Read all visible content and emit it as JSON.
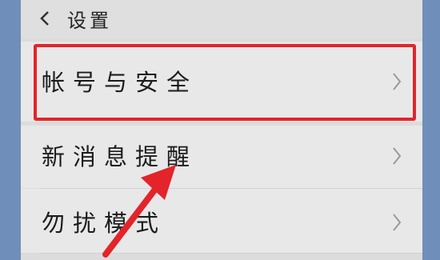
{
  "header": {
    "title": "设置"
  },
  "items": [
    {
      "label": "帐号与安全"
    },
    {
      "label": "新消息提醒"
    },
    {
      "label": "勿扰模式"
    }
  ],
  "icons": {
    "back": "chevron-left-icon",
    "row": "chevron-right-icon",
    "annotation": "red-arrow"
  },
  "colors": {
    "highlight": "#e3242b",
    "page_bg": "#e8e8e8",
    "frame_bg": "#6f8fba"
  }
}
